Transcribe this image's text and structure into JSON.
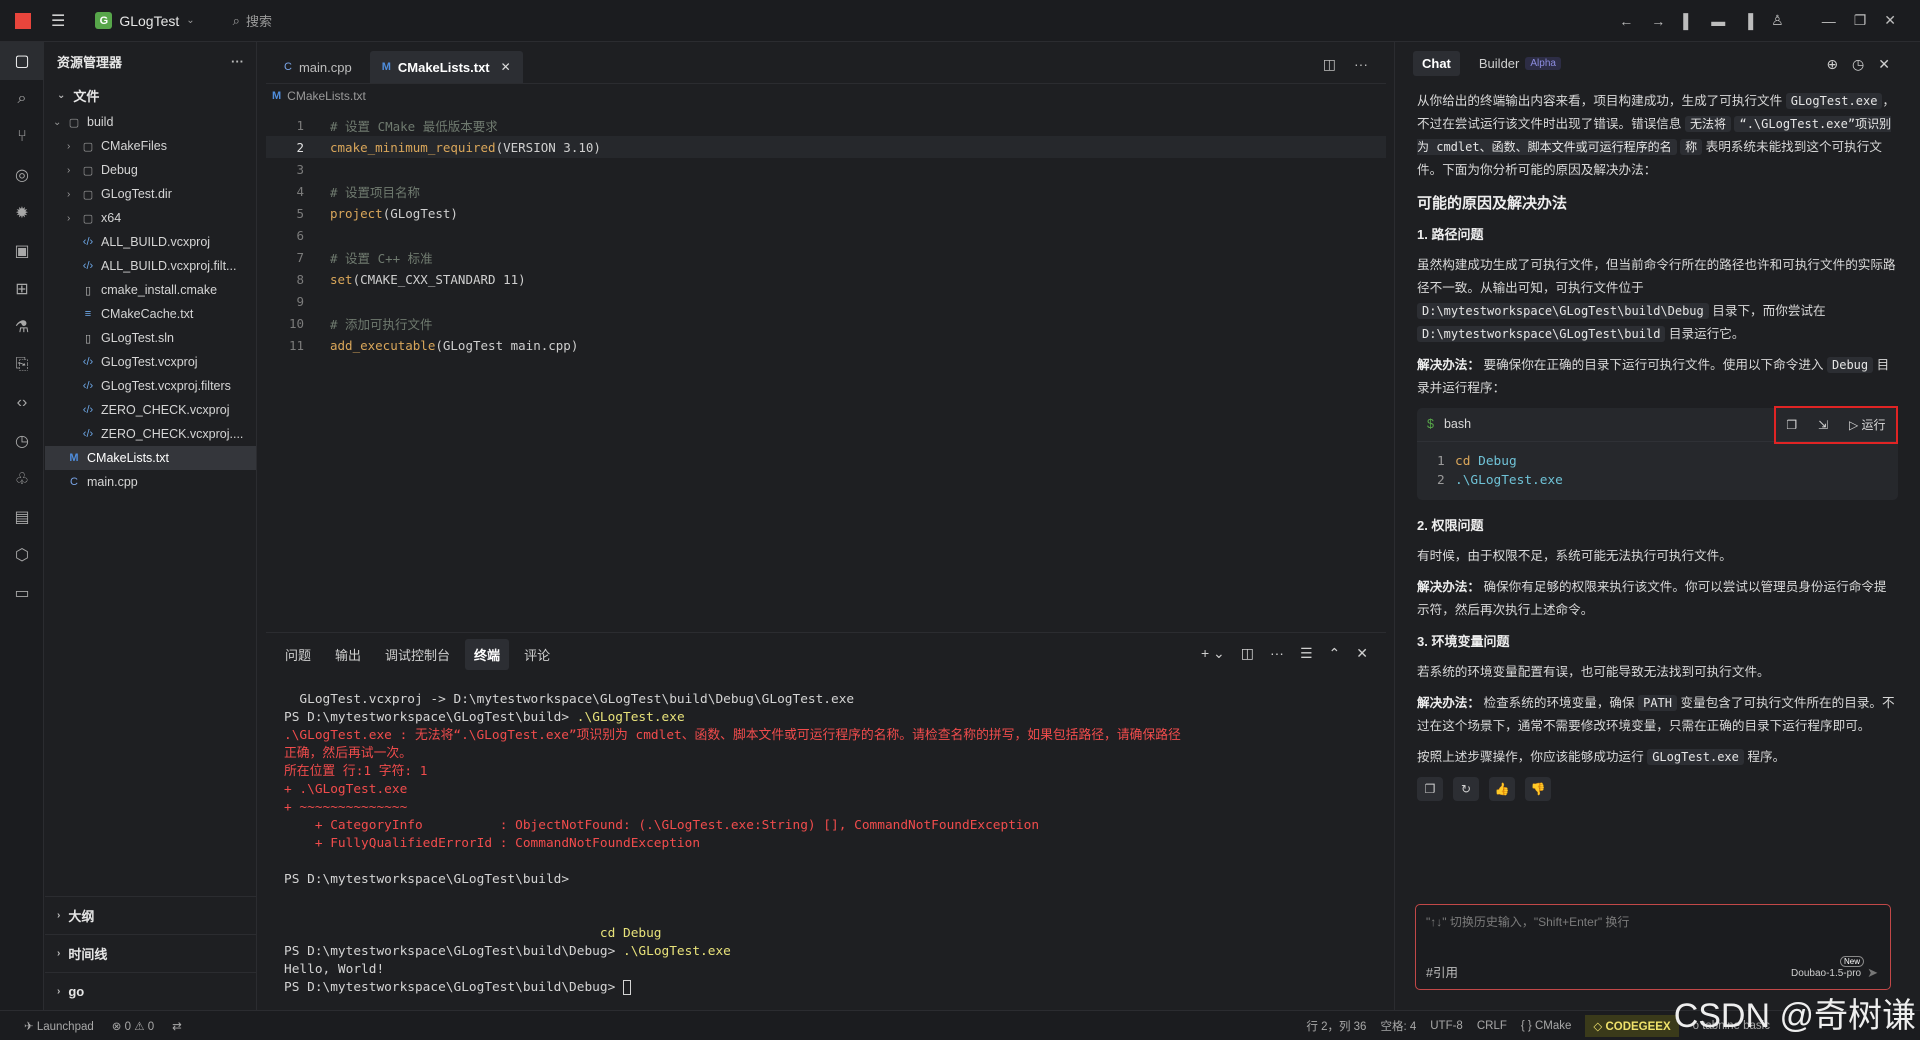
{
  "titlebar": {
    "project": "GLogTest",
    "project_badge": "G",
    "search": "搜索"
  },
  "explorer": {
    "title": "资源管理器",
    "section_files": "文件",
    "tree": [
      {
        "label": "build",
        "type": "folder",
        "level": 0,
        "open": true
      },
      {
        "label": "CMakeFiles",
        "type": "folder",
        "level": 1
      },
      {
        "label": "Debug",
        "type": "folder",
        "level": 1
      },
      {
        "label": "GLogTest.dir",
        "type": "folder",
        "level": 1
      },
      {
        "label": "x64",
        "type": "folder",
        "level": 1
      },
      {
        "label": "ALL_BUILD.vcxproj",
        "type": "xml",
        "level": 1
      },
      {
        "label": "ALL_BUILD.vcxproj.filt...",
        "type": "xml",
        "level": 1
      },
      {
        "label": "cmake_install.cmake",
        "type": "file",
        "level": 1
      },
      {
        "label": "CMakeCache.txt",
        "type": "lines",
        "level": 1
      },
      {
        "label": "GLogTest.sln",
        "type": "file",
        "level": 1
      },
      {
        "label": "GLogTest.vcxproj",
        "type": "xml",
        "level": 1
      },
      {
        "label": "GLogTest.vcxproj.filters",
        "type": "xml",
        "level": 1
      },
      {
        "label": "ZERO_CHECK.vcxproj",
        "type": "xml",
        "level": 1
      },
      {
        "label": "ZERO_CHECK.vcxproj....",
        "type": "xml",
        "level": 1
      },
      {
        "label": "CMakeLists.txt",
        "type": "cmake",
        "level": 0,
        "selected": true
      },
      {
        "label": "main.cpp",
        "type": "cpp",
        "level": 0
      }
    ],
    "section_outline": "大纲",
    "section_timeline": "时间线",
    "section_go": "go"
  },
  "editor": {
    "tabs": [
      {
        "label": "main.cpp",
        "icon": "C"
      },
      {
        "label": "CMakeLists.txt",
        "icon": "M",
        "active": true
      }
    ],
    "breadcrumb": "CMakeLists.txt",
    "lines": [
      {
        "n": "1",
        "comment": "# 设置 CMake 最低版本要求"
      },
      {
        "n": "2",
        "fn": "cmake_minimum_required",
        "args": "(VERSION 3.10)",
        "current": true
      },
      {
        "n": "3"
      },
      {
        "n": "4",
        "comment": "# 设置项目名称"
      },
      {
        "n": "5",
        "fn": "project",
        "args": "(GLogTest)"
      },
      {
        "n": "6"
      },
      {
        "n": "7",
        "comment": "# 设置 C++ 标准"
      },
      {
        "n": "8",
        "fn": "set",
        "args": "(CMAKE_CXX_STANDARD 11)"
      },
      {
        "n": "9"
      },
      {
        "n": "10",
        "comment": "# 添加可执行文件"
      },
      {
        "n": "11",
        "fn": "add_executable",
        "args": "(GLogTest main.cpp)"
      }
    ]
  },
  "panel": {
    "tabs": [
      "问题",
      "输出",
      "调试控制台",
      "终端",
      "评论"
    ],
    "active_tab": "终端",
    "terminal": [
      {
        "cls": "t-norm",
        "text": "  GLogTest.vcxproj -> D:\\mytestworkspace\\GLogTest\\build\\Debug\\GLogTest.exe"
      },
      {
        "cls": "t-norm",
        "text": "PS D:\\mytestworkspace\\GLogTest\\build> ",
        "extra": ".\\GLogTest.exe"
      },
      {
        "cls": "t-red",
        "text": ".\\GLogTest.exe : 无法将“.\\GLogTest.exe”项识别为 cmdlet、函数、脚本文件或可运行程序的名称。请检查名称的拼写，如果包括路径，请确保路径"
      },
      {
        "cls": "t-red",
        "text": "正确，然后再试一次。"
      },
      {
        "cls": "t-red",
        "text": "所在位置 行:1 字符: 1"
      },
      {
        "cls": "t-red",
        "text": "+ .\\GLogTest.exe"
      },
      {
        "cls": "t-red",
        "text": "+ ~~~~~~~~~~~~~~"
      },
      {
        "cls": "t-red",
        "text": "    + CategoryInfo          : ObjectNotFound: (.\\GLogTest.exe:String) [], CommandNotFoundException"
      },
      {
        "cls": "t-red",
        "text": "    + FullyQualifiedErrorId : CommandNotFoundException"
      },
      {
        "cls": "t-norm",
        "text": " "
      },
      {
        "cls": "t-norm",
        "text": "PS D:\\mytestworkspace\\GLogTest\\build>"
      },
      {
        "cls": "t-norm",
        "text": " "
      },
      {
        "cls": "t-norm",
        "text": " "
      },
      {
        "cls": "t-yel",
        "text": "                                         cd Debug"
      },
      {
        "cls": "t-norm",
        "text": "PS D:\\mytestworkspace\\GLogTest\\build\\Debug> ",
        "extra": ".\\GLogTest.exe"
      },
      {
        "cls": "t-norm",
        "text": "Hello, World!"
      },
      {
        "cls": "t-norm",
        "text": "PS D:\\mytestworkspace\\GLogTest\\build\\Debug> ",
        "cursor": true
      }
    ]
  },
  "chat": {
    "tab_chat": "Chat",
    "tab_builder": "Builder",
    "alpha": "Alpha",
    "intro_1": "从你给出的终端输出内容来看，项目构建成功，生成了可执行文件",
    "intro_code_1": "GLogTest.exe",
    "intro_2": "，不过在尝试运行该文件时出现了错误。错误信息",
    "intro_code_2": "无法将",
    "intro_code_3": "“.\\GLogTest.exe”项识别为 cmdlet、函数、脚本文件或可运行程序的名",
    "intro_code_4": "称",
    "intro_3": "表明系统未能找到这个可执行文件。下面为你分析可能的原因及解决办法：",
    "heading": "可能的原因及解决办法",
    "s1_title": "1. 路径问题",
    "s1_p1": "虽然构建成功生成了可执行文件，但当前命令行所在的路径也许和可执行文件的实际路径不一致。从输出可知，可执行文件位于",
    "s1_code1": "D:\\mytestworkspace\\GLogTest\\build\\Debug",
    "s1_p2": "目录下，而你尝试在",
    "s1_code2": "D:\\mytestworkspace\\GLogTest\\build",
    "s1_p3": "目录运行它。",
    "s1_sol_label": "解决办法：",
    "s1_sol": "要确保你在正确的目录下运行可执行文件。使用以下命令进入",
    "s1_sol_code": "Debug",
    "s1_sol_2": "目录并运行程序：",
    "code_lang": "bash",
    "code_run": "运行",
    "code_lines": [
      {
        "n": "1",
        "kw": "cd",
        "arg": "Debug"
      },
      {
        "n": "2",
        "kw": "",
        "arg": ".\\GLogTest.exe"
      }
    ],
    "s2_title": "2. 权限问题",
    "s2_p": "有时候，由于权限不足，系统可能无法执行可执行文件。",
    "s2_sol_label": "解决办法：",
    "s2_sol": "确保你有足够的权限来执行该文件。你可以尝试以管理员身份运行命令提示符，然后再次执行上述命令。",
    "s3_title": "3. 环境变量问题",
    "s3_p": "若系统的环境变量配置有误，也可能导致无法找到可执行文件。",
    "s3_sol_label": "解决办法：",
    "s3_sol": "检查系统的环境变量，确保",
    "s3_code": "PATH",
    "s3_sol_2": "变量包含了可执行文件所在的目录。不过在这个场景下，通常不需要修改环境变量，只需在正确的目录下运行程序即可。",
    "final_1": "按照上述步骤操作，你应该能够成功运行",
    "final_code": "GLogTest.exe",
    "final_2": "程序。",
    "input_placeholder": "\"↑↓\" 切换历史输入，\"Shift+Enter\" 换行",
    "input_ref": "#引用",
    "model": "Doubao-1.5-pro",
    "new_badge": "New"
  },
  "statusbar": {
    "launchpad": "Launchpad",
    "errors": "0",
    "warnings": "0",
    "position": "行 2，列 36",
    "spaces": "空格: 4",
    "encoding": "UTF-8",
    "eol": "CRLF",
    "language": "CMake",
    "codegeex": "CODEGEEX",
    "tabnine": "o tabnine basic"
  },
  "watermark": "CSDN @奇树谦"
}
